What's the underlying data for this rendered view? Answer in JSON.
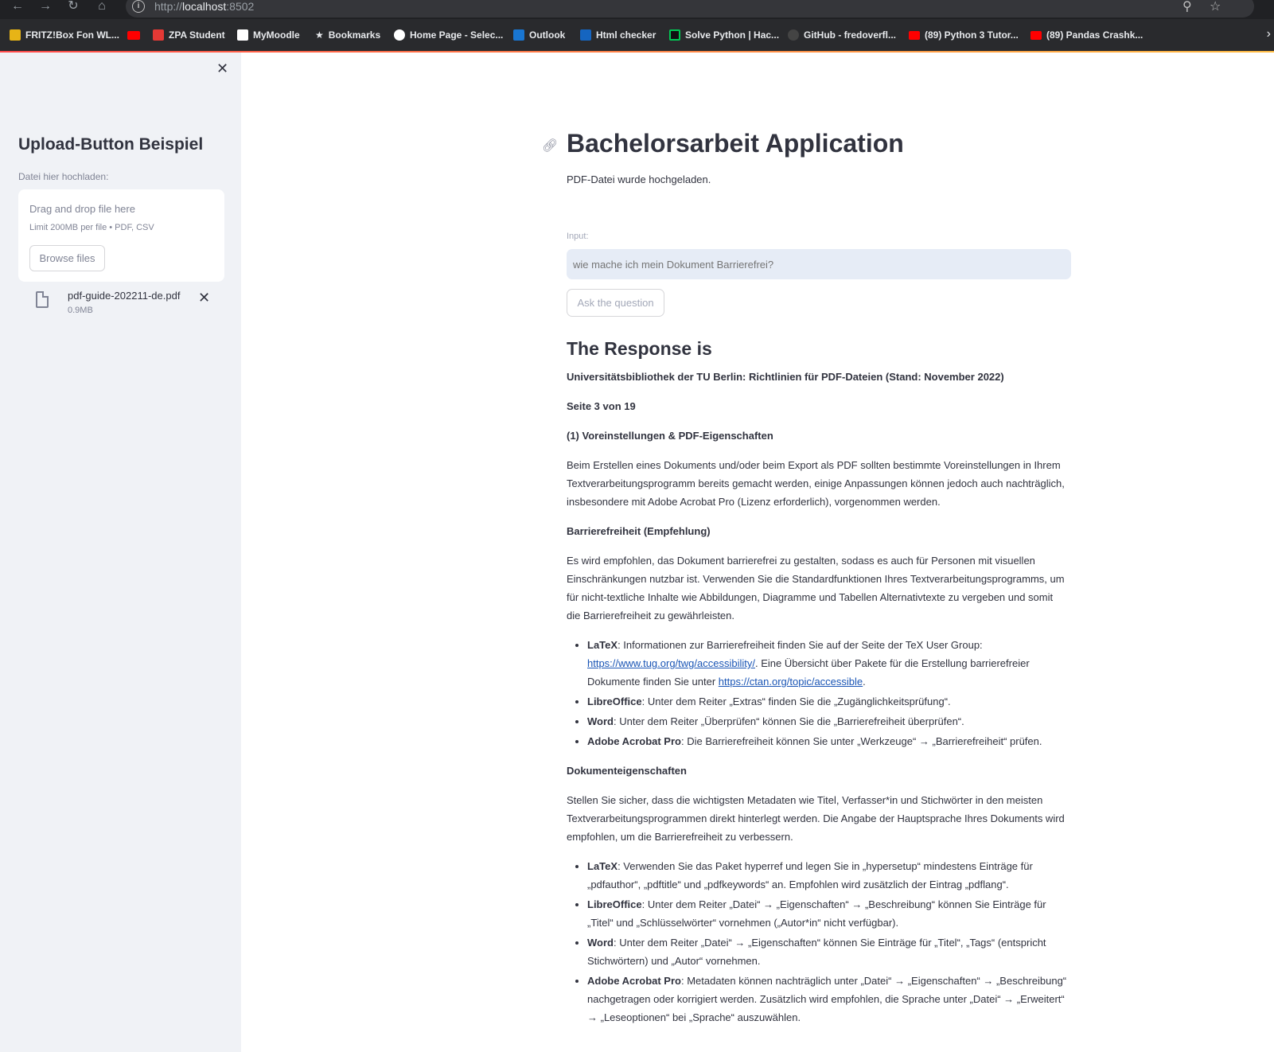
{
  "browser": {
    "url_prefix": "http://",
    "url_host": "localhost",
    "url_port": ":8502",
    "bookmarks": [
      {
        "label": "FRITZ!Box Fon WL...",
        "color": "#e7b416"
      },
      {
        "label": "",
        "color": "#ff0000"
      },
      {
        "label": "ZPA Student",
        "color": "#e53935"
      },
      {
        "label": "MyMoodle",
        "color": "#ffffff"
      },
      {
        "label": "Bookmarks",
        "color": "#ffffff"
      },
      {
        "label": "Home Page - Selec...",
        "color": "#ffffff"
      },
      {
        "label": "Outlook",
        "color": "#1976d2"
      },
      {
        "label": "Html checker",
        "color": "#1565c0"
      },
      {
        "label": "Solve Python | Hac...",
        "color": "#00c853"
      },
      {
        "label": "GitHub - fredoverfl...",
        "color": "#222222"
      },
      {
        "label": "(89) Python 3 Tutor...",
        "color": "#ff0000"
      },
      {
        "label": "(89) Pandas Crashk...",
        "color": "#ff0000"
      }
    ]
  },
  "sidebar": {
    "title": "Upload-Button Beispiel",
    "upload_label": "Datei hier hochladen:",
    "dropzone_text": "Drag and drop file here",
    "dropzone_limit": "Limit 200MB per file • PDF, CSV",
    "browse_label": "Browse files",
    "file_name": "pdf-guide-202211-de.pdf",
    "file_size": "0.9MB"
  },
  "main": {
    "title": "Bachelorsarbeit Application",
    "status": "PDF-Datei wurde hochgeladen.",
    "input_label": "Input:",
    "input_placeholder": "wie mache ich mein Dokument Barrierefrei?",
    "ask_label": "Ask the question",
    "response_heading": "The Response is",
    "response": {
      "line1": "Universitätsbibliothek der TU Berlin: Richtlinien für PDF-Dateien (Stand: November 2022)",
      "line2": "Seite 3 von 19",
      "section1": "(1) Voreinstellungen & PDF-Eigenschaften",
      "para1": "Beim Erstellen eines Dokuments und/oder beim Export als PDF sollten bestimmte Voreinstellungen in Ihrem Textverarbeitungsprogramm bereits gemacht werden, einige Anpassungen können jedoch auch nachträglich, insbesondere mit Adobe Acrobat Pro (Lizenz erforderlich), vorgenommen werden.",
      "section2": "Barrierefreiheit (Empfehlung)",
      "para2": "Es wird empfohlen, das Dokument barrierefrei zu gestalten, sodass es auch für Personen mit visuellen Einschränkungen nutzbar ist. Verwenden Sie die Standardfunktionen Ihres Textverarbeitungsprogramms, um für nicht-textliche Inhalte wie Abbildungen, Diagramme und Tabellen Alternativtexte zu vergeben und somit die Barrierefreiheit zu gewährleisten.",
      "list1": {
        "latex_name": "LaTeX",
        "latex_text1": ": Informationen zur Barrierefreiheit finden Sie auf der Seite der TeX User Group: ",
        "latex_link1": "https://www.tug.org/twg/accessibility/",
        "latex_text2": ". Eine Übersicht über Pakete für die Erstellung barrierefreier Dokumente finden Sie unter ",
        "latex_link2": "https://ctan.org/topic/accessible",
        "latex_text3": ".",
        "libre_name": "LibreOffice",
        "libre_text": ": Unter dem Reiter „Extras“ finden Sie die „Zugänglichkeitsprüfung“.",
        "word_name": "Word",
        "word_text": ": Unter dem Reiter „Überprüfen“ können Sie die „Barrierefreiheit überprüfen“.",
        "acro_name": "Adobe Acrobat Pro",
        "acro_text": ": Die Barrierefreiheit können Sie unter „Werkzeuge“ → „Barrierefreiheit“ prüfen."
      },
      "section3": "Dokumenteigenschaften",
      "para3": "Stellen Sie sicher, dass die wichtigsten Metadaten wie Titel, Verfasser*in und Stichwörter in den meisten Textverarbeitungsprogrammen direkt hinterlegt werden. Die Angabe der Hauptsprache Ihres Dokuments wird empfohlen, um die Barrierefreiheit zu verbessern.",
      "list2": {
        "latex_name": "LaTeX",
        "latex_text": ": Verwenden Sie das Paket hyperref und legen Sie in „hypersetup“ mindestens Einträge für „pdfauthor“, „pdftitle“ und „pdfkeywords“ an. Empfohlen wird zusätzlich der Eintrag „pdflang“.",
        "libre_name": "LibreOffice",
        "libre_text": ": Unter dem Reiter „Datei“ → „Eigenschaften“ → „Beschreibung“ können Sie Einträge für „Titel“ und „Schlüsselwörter“ vornehmen („Autor*in“ nicht verfügbar).",
        "word_name": "Word",
        "word_text": ": Unter dem Reiter „Datei“ → „Eigenschaften“ können Sie Einträge für „Titel“, „Tags“ (entspricht Stichwörtern) und „Autor“ vornehmen.",
        "acro_name": "Adobe Acrobat Pro",
        "acro_text": ": Metadaten können nachträglich unter „Datei“ → „Eigenschaften“ → „Beschreibung“ nachgetragen oder korrigiert werden. Zusätzlich wird empfohlen, die Sprache unter „Datei“ → „Erweitert“ → „Leseoptionen“ bei „Sprache“ auszuwählen."
      }
    }
  }
}
